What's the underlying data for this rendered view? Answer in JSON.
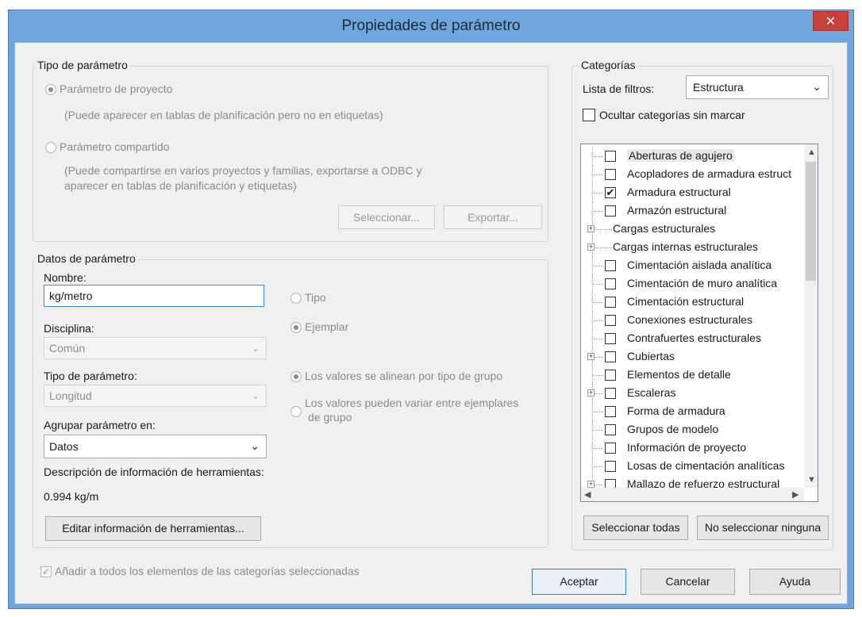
{
  "dialog": {
    "title": "Propiedades de parámetro",
    "close": "✕"
  },
  "tipo_parametro": {
    "legend": "Tipo de parámetro",
    "proyecto_label": "Parámetro de proyecto",
    "proyecto_desc": "(Puede aparecer en tablas de planificación pero no en etiquetas)",
    "compartido_label": "Parámetro compartido",
    "compartido_desc_1": "(Puede compartirse en varios proyectos y familias, exportarse a ODBC y",
    "compartido_desc_2": "aparecer en tablas de planificación y etiquetas)",
    "seleccionar": "Seleccionar...",
    "exportar": "Exportar..."
  },
  "datos": {
    "legend": "Datos de parámetro",
    "nombre_label": "Nombre:",
    "nombre_value": "kg/metro",
    "disciplina_label": "Disciplina:",
    "disciplina_value": "Común",
    "tipo_label": "Tipo de parámetro:",
    "tipo_value": "Longitud",
    "agrupar_label": "Agrupar parámetro en:",
    "agrupar_value": "Datos",
    "descripcion_label": "Descripción de información de herramientas:",
    "descripcion_value": "0.994 kg/m",
    "editar_btn": "Editar información de herramientas...",
    "radio_tipo": "Tipo",
    "radio_ejemplar": "Ejemplar",
    "radio_alinean": "Los valores se alinean por tipo de grupo",
    "radio_variar_1": "Los valores pueden variar entre ejemplares",
    "radio_variar_2": "de grupo"
  },
  "categorias": {
    "legend": "Categorías",
    "filtros_label": "Lista de filtros:",
    "filtros_value": "Estructura",
    "ocultar_label": "Ocultar categorías sin marcar",
    "items": [
      {
        "label": "Aberturas de agujero",
        "checked": false,
        "expand": false
      },
      {
        "label": "Acopladores de armadura estruct",
        "checked": false,
        "expand": false
      },
      {
        "label": "Armadura estructural",
        "checked": true,
        "expand": false
      },
      {
        "label": "Armazón estructural",
        "checked": false,
        "expand": false
      },
      {
        "label": "Cargas estructurales",
        "checked": null,
        "expand": true
      },
      {
        "label": "Cargas internas estructurales",
        "checked": null,
        "expand": true
      },
      {
        "label": "Cimentación aislada analítica",
        "checked": false,
        "expand": false
      },
      {
        "label": "Cimentación de muro analítica",
        "checked": false,
        "expand": false
      },
      {
        "label": "Cimentación estructural",
        "checked": false,
        "expand": false
      },
      {
        "label": "Conexiones estructurales",
        "checked": false,
        "expand": false
      },
      {
        "label": "Contrafuertes estructurales",
        "checked": false,
        "expand": false
      },
      {
        "label": "Cubiertas",
        "checked": false,
        "expand": true
      },
      {
        "label": "Elementos de detalle",
        "checked": false,
        "expand": false
      },
      {
        "label": "Escaleras",
        "checked": false,
        "expand": true
      },
      {
        "label": "Forma de armadura",
        "checked": false,
        "expand": false
      },
      {
        "label": "Grupos de modelo",
        "checked": false,
        "expand": false
      },
      {
        "label": "Información de proyecto",
        "checked": false,
        "expand": false
      },
      {
        "label": "Losas de cimentación analíticas",
        "checked": false,
        "expand": false
      },
      {
        "label": "Mallazo de refuerzo estructural",
        "checked": false,
        "expand": true
      }
    ],
    "sel_todas": "Seleccionar todas",
    "no_sel": "No seleccionar ninguna"
  },
  "footer": {
    "anadir_label": "Añadir a todos los elementos de las categorías seleccionadas",
    "aceptar": "Aceptar",
    "cancelar": "Cancelar",
    "ayuda": "Ayuda"
  }
}
